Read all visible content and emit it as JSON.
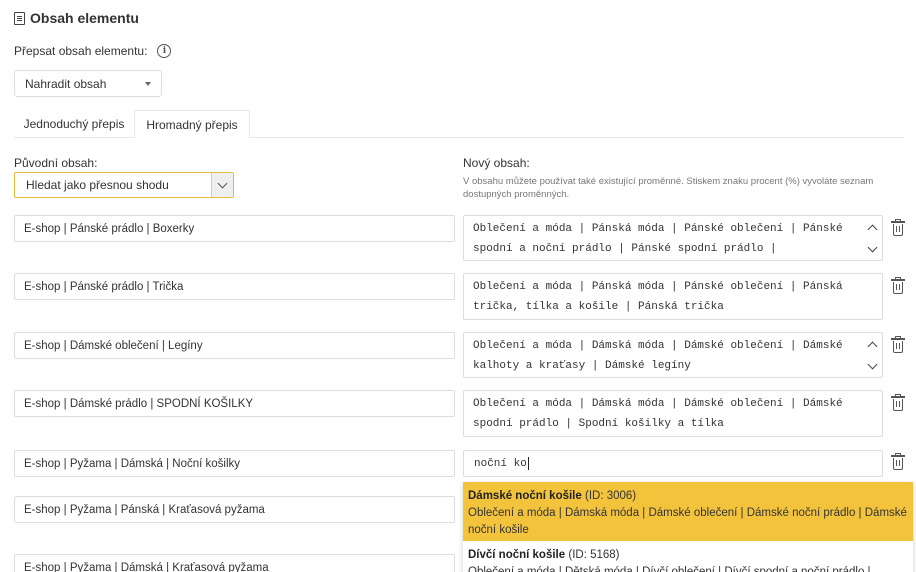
{
  "section": {
    "title": "Obsah elementu",
    "icon": "document-icon"
  },
  "override": {
    "label": "Přepsat obsah elementu:",
    "mode_value": "Nahradit obsah"
  },
  "tabs": [
    {
      "label": "Jednoduchý přepis",
      "active": false
    },
    {
      "label": "Hromadný přepis",
      "active": true
    }
  ],
  "original": {
    "label": "Původní obsah:",
    "match_mode": "Hledat jako přesnou shodu"
  },
  "new_content": {
    "label": "Nový obsah:",
    "hint": "V obsahu můžete používat také existující proměnné. Stiskem znaku procent (%) vyvoláte seznam dostupných proměnných."
  },
  "rows": [
    {
      "original": "E-shop | Pánské prádlo | Boxerky",
      "new": "Oblečení a móda | Pánská móda | Pánské oblečení | Pánské spodní a noční prádlo | Pánské spodní prádlo |"
    },
    {
      "original": "E-shop | Pánské prádlo | Trička",
      "new": "Oblečení a móda | Pánská móda | Pánské oblečení | Pánská trička, tílka a košile | Pánská trička"
    },
    {
      "original": "E-shop | Dámské oblečení | Legíny",
      "new": "Oblečení a móda | Dámská móda | Dámské oblečení | Dámské kalhoty a kraťasy | Dámské legíny"
    },
    {
      "original": "E-shop | Dámské prádlo | SPODNÍ KOŠILKY",
      "new": "Oblečení a móda | Dámská móda | Dámské oblečení | Dámské spodní prádlo | Spodní košilky a tílka"
    },
    {
      "original": "E-shop | Pyžama | Dámská | Noční košilky",
      "new": "noční ko"
    },
    {
      "original": "E-shop | Pyžama | Pánská | Kraťasová pyžama"
    },
    {
      "original": "E-shop | Pyžama | Dámská | Kraťasová pyžama"
    }
  ],
  "suggestions": [
    {
      "name": "Dámské noční košile",
      "id": "(ID: 3006)",
      "path": "Oblečení a móda | Dámská móda | Dámské oblečení | Dámské noční prádlo | Dámské noční košile",
      "highlighted": true
    },
    {
      "name": "Dívčí noční košile",
      "id": "(ID: 5168)",
      "path": "Oblečení a móda | Dětská móda | Dívčí oblečení | Dívčí spodní a noční prádlo |",
      "highlighted": false
    }
  ],
  "colors": {
    "highlight": "#f3c43b",
    "focus_border": "#e7b93a"
  }
}
